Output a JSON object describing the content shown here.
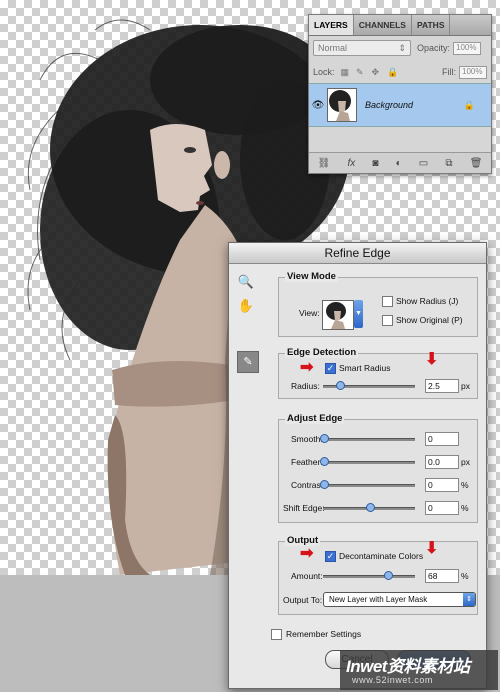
{
  "layers_panel": {
    "tabs": [
      "LAYERS",
      "CHANNELS",
      "PATHS"
    ],
    "blend_mode": "Normal",
    "opacity_label": "Opacity:",
    "opacity_value": "100%",
    "lock_label": "Lock:",
    "fill_label": "Fill:",
    "fill_value": "100%",
    "layer_name": "Background",
    "footer_icons": [
      "link-icon",
      "fx-icon",
      "mask-icon",
      "adjustment-icon",
      "group-icon",
      "new-layer-icon",
      "trash-icon"
    ]
  },
  "dialog": {
    "title": "Refine Edge",
    "view_mode": {
      "title": "View Mode",
      "view_label": "View:",
      "show_radius": "Show Radius (J)",
      "show_original": "Show Original (P)"
    },
    "edge_detection": {
      "title": "Edge Detection",
      "smart_radius": "Smart Radius",
      "radius_label": "Radius:",
      "radius_value": "2.5",
      "radius_unit": "px"
    },
    "adjust_edge": {
      "title": "Adjust Edge",
      "smooth_label": "Smooth:",
      "smooth_value": "0",
      "feather_label": "Feather:",
      "feather_value": "0.0",
      "feather_unit": "px",
      "contrast_label": "Contrast:",
      "contrast_value": "0",
      "contrast_unit": "%",
      "shift_label": "Shift Edge:",
      "shift_value": "0",
      "shift_unit": "%"
    },
    "output": {
      "title": "Output",
      "decontaminate": "Decontaminate Colors",
      "amount_label": "Amount:",
      "amount_value": "68",
      "amount_unit": "%",
      "output_to_label": "Output To:",
      "output_to_value": "New Layer with Layer Mask"
    },
    "remember": "Remember Settings",
    "cancel": "Cancel"
  },
  "watermark": {
    "line1": "Inwet资料素材站",
    "line2": "www.52inwet.com"
  },
  "colors": {
    "accent": "#3b6fd1",
    "arrow": "#d4141a",
    "layer_highlight": "#a5c9ee"
  }
}
